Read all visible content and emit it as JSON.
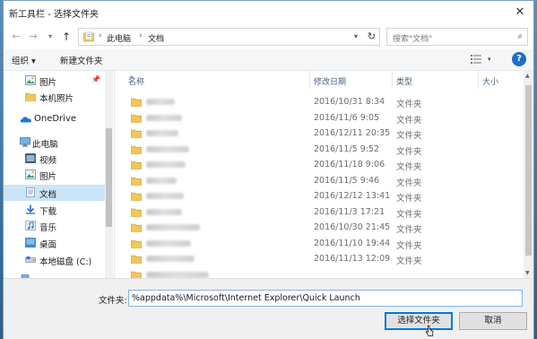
{
  "window": {
    "title": "新工具栏 - 选择文件夹"
  },
  "nav": {
    "breadcrumb": [
      "此电脑",
      "文档"
    ],
    "search_placeholder": "搜索\"文档\""
  },
  "toolbar": {
    "organize": "组织 ▾",
    "new_folder": "新建文件夹"
  },
  "sidebar": {
    "items": [
      {
        "label": "图片",
        "icon": "pictures-icon"
      },
      {
        "label": "本机照片",
        "icon": "folder-icon"
      },
      {
        "label": "OneDrive",
        "icon": "onedrive-icon"
      },
      {
        "label": "此电脑",
        "icon": "computer-icon"
      },
      {
        "label": "视频",
        "icon": "videos-icon"
      },
      {
        "label": "图片",
        "icon": "pictures-icon"
      },
      {
        "label": "文档",
        "icon": "documents-icon"
      },
      {
        "label": "下载",
        "icon": "downloads-icon"
      },
      {
        "label": "音乐",
        "icon": "music-icon"
      },
      {
        "label": "桌面",
        "icon": "desktop-icon"
      },
      {
        "label": "本地磁盘 (C:)",
        "icon": "drive-icon"
      }
    ]
  },
  "files": {
    "headers": {
      "name": "名称",
      "date": "修改日期",
      "type": "类型",
      "size": "大小"
    },
    "rows": [
      {
        "date": "2016/10/31 8:34",
        "type": "文件夹"
      },
      {
        "date": "2016/11/6 9:05",
        "type": "文件夹"
      },
      {
        "date": "2016/12/11 20:35",
        "type": "文件夹"
      },
      {
        "date": "2016/11/5 9:52",
        "type": "文件夹"
      },
      {
        "date": "2016/11/18 9:06",
        "type": "文件夹"
      },
      {
        "date": "2016/11/5 9:46",
        "type": "文件夹"
      },
      {
        "date": "2016/12/12 13:41",
        "type": "文件夹"
      },
      {
        "date": "2016/11/3 17:21",
        "type": "文件夹"
      },
      {
        "date": "2016/10/30 21:45",
        "type": "文件夹"
      },
      {
        "date": "2016/11/10 19:44",
        "type": "文件夹"
      },
      {
        "date": "2016/11/13 12:09",
        "type": "文件夹"
      }
    ]
  },
  "footer": {
    "folder_label": "文件夹:",
    "folder_value": "%appdata%\\Microsoft\\Internet Explorer\\Quick Launch",
    "select_button": "选择文件夹",
    "cancel_button": "取消"
  },
  "colors": {
    "accent": "#0078d7",
    "selection": "#cce4f7",
    "folder": "#e8b84a"
  }
}
